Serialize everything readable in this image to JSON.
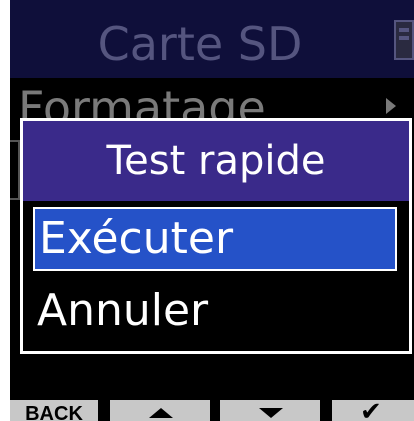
{
  "screen": {
    "title": "Carte SD",
    "background_item": "Formatage"
  },
  "dialog": {
    "title": "Test rapide",
    "items": [
      {
        "label": "Exécuter",
        "selected": true
      },
      {
        "label": "Annuler",
        "selected": false
      }
    ]
  },
  "bottom_bar": {
    "back_label": "BACK",
    "up_icon": "triangle-up-icon",
    "down_icon": "triangle-down-icon",
    "confirm_icon": "checkmark-icon",
    "check_glyph": "✔"
  },
  "colors": {
    "header_bg": "#0f0f3a",
    "dialog_title_bg": "#3a2a8a",
    "selection_bg": "#2552c8",
    "button_bg": "#c8c8c8"
  }
}
